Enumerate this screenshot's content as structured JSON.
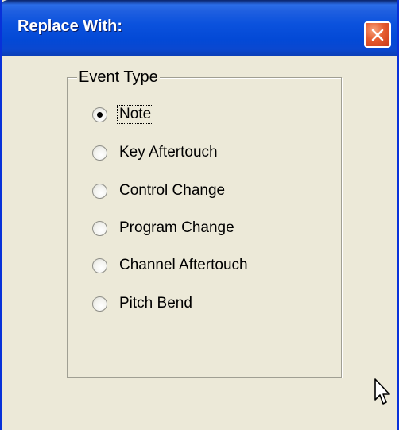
{
  "window": {
    "title": "Replace With:",
    "close_icon": "close-x-icon",
    "title_color": "#0b52dd",
    "frame_color": "#0831d9",
    "body_color": "#ece9d8"
  },
  "group": {
    "label": "Event Type"
  },
  "event_types": [
    {
      "label": "Note",
      "checked": true
    },
    {
      "label": "Key Aftertouch",
      "checked": false
    },
    {
      "label": "Control Change",
      "checked": false
    },
    {
      "label": "Program Change",
      "checked": false
    },
    {
      "label": "Channel Aftertouch",
      "checked": false
    },
    {
      "label": "Pitch Bend",
      "checked": false
    }
  ],
  "pointer": "mouse-arrow-icon"
}
